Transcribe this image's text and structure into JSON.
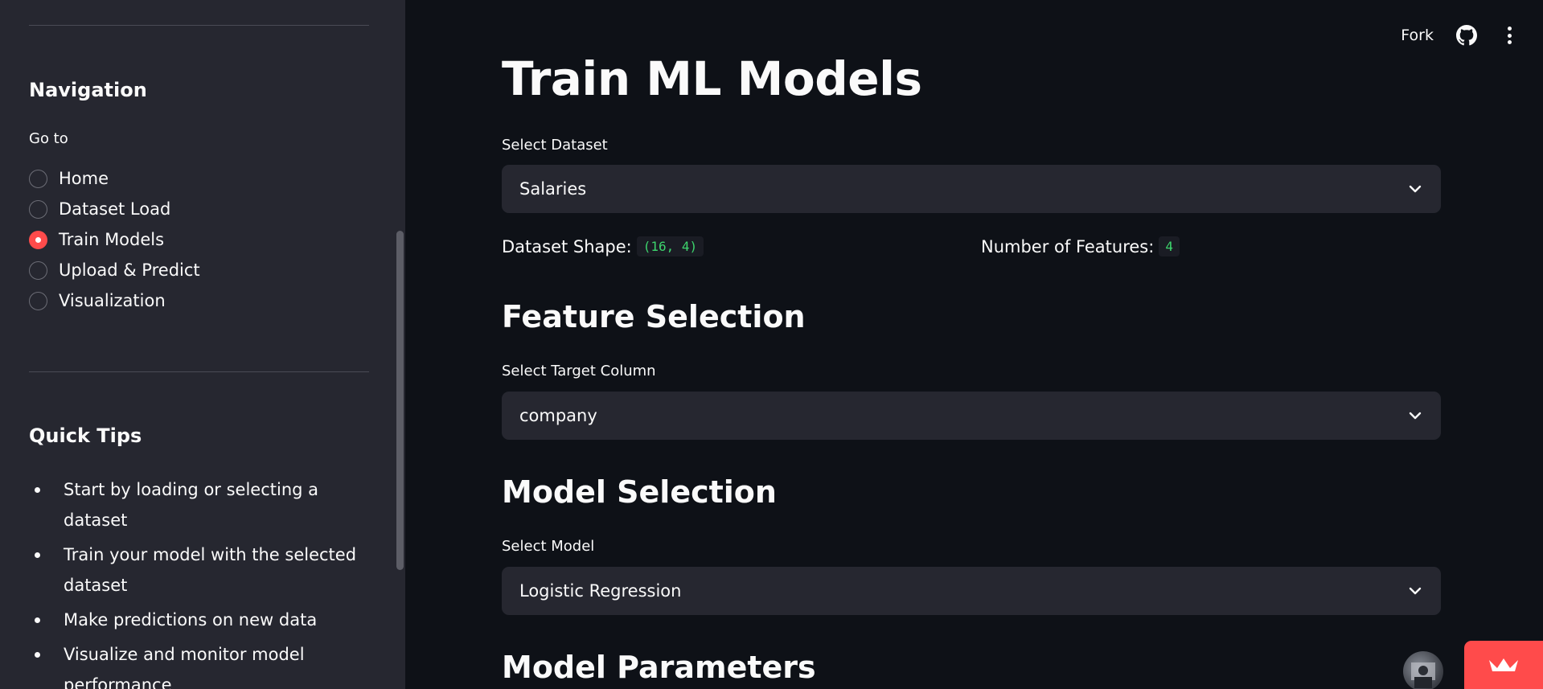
{
  "sidebar": {
    "navigation_title": "Navigation",
    "goto_label": "Go to",
    "nav_options": [
      {
        "label": "Home",
        "selected": false
      },
      {
        "label": "Dataset Load",
        "selected": false
      },
      {
        "label": "Train Models",
        "selected": true
      },
      {
        "label": "Upload & Predict",
        "selected": false
      },
      {
        "label": "Visualization",
        "selected": false
      }
    ],
    "tips_title": "Quick Tips",
    "tips": [
      "Start by loading or selecting a dataset",
      "Train your model with the selected dataset",
      "Make predictions on new data",
      "Visualize and monitor model performance"
    ]
  },
  "header": {
    "fork_label": "Fork",
    "icons": [
      "github-icon",
      "kebab-menu-icon"
    ]
  },
  "main": {
    "title": "Train ML Models",
    "dataset_select": {
      "label": "Select Dataset",
      "value": "Salaries"
    },
    "dataset_shape": {
      "label": "Dataset Shape:",
      "value": "(16, 4)"
    },
    "num_features": {
      "label": "Number of Features:",
      "value": "4"
    },
    "feature_section_title": "Feature Selection",
    "target_select": {
      "label": "Select Target Column",
      "value": "company"
    },
    "model_section_title": "Model Selection",
    "model_select": {
      "label": "Select Model",
      "value": "Logistic Regression"
    },
    "params_section_title": "Model Parameters"
  },
  "colors": {
    "accent": "#ff4b4b",
    "background": "#0e1117",
    "sidebar": "#262730",
    "code_green": "#3dd56d"
  }
}
